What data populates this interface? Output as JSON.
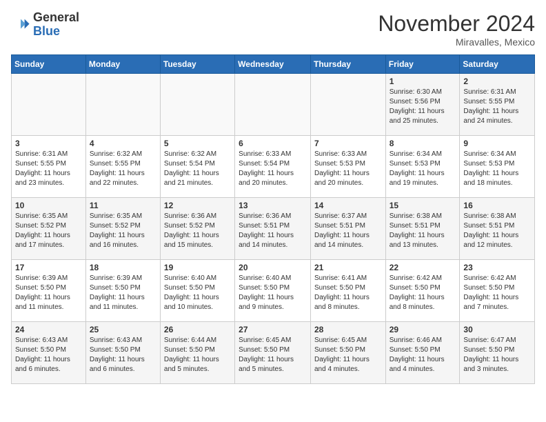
{
  "header": {
    "logo_general": "General",
    "logo_blue": "Blue",
    "month": "November 2024",
    "location": "Miravalles, Mexico"
  },
  "weekdays": [
    "Sunday",
    "Monday",
    "Tuesday",
    "Wednesday",
    "Thursday",
    "Friday",
    "Saturday"
  ],
  "weeks": [
    [
      {
        "day": "",
        "info": ""
      },
      {
        "day": "",
        "info": ""
      },
      {
        "day": "",
        "info": ""
      },
      {
        "day": "",
        "info": ""
      },
      {
        "day": "",
        "info": ""
      },
      {
        "day": "1",
        "info": "Sunrise: 6:30 AM\nSunset: 5:56 PM\nDaylight: 11 hours and 25 minutes."
      },
      {
        "day": "2",
        "info": "Sunrise: 6:31 AM\nSunset: 5:55 PM\nDaylight: 11 hours and 24 minutes."
      }
    ],
    [
      {
        "day": "3",
        "info": "Sunrise: 6:31 AM\nSunset: 5:55 PM\nDaylight: 11 hours and 23 minutes."
      },
      {
        "day": "4",
        "info": "Sunrise: 6:32 AM\nSunset: 5:55 PM\nDaylight: 11 hours and 22 minutes."
      },
      {
        "day": "5",
        "info": "Sunrise: 6:32 AM\nSunset: 5:54 PM\nDaylight: 11 hours and 21 minutes."
      },
      {
        "day": "6",
        "info": "Sunrise: 6:33 AM\nSunset: 5:54 PM\nDaylight: 11 hours and 20 minutes."
      },
      {
        "day": "7",
        "info": "Sunrise: 6:33 AM\nSunset: 5:53 PM\nDaylight: 11 hours and 20 minutes."
      },
      {
        "day": "8",
        "info": "Sunrise: 6:34 AM\nSunset: 5:53 PM\nDaylight: 11 hours and 19 minutes."
      },
      {
        "day": "9",
        "info": "Sunrise: 6:34 AM\nSunset: 5:53 PM\nDaylight: 11 hours and 18 minutes."
      }
    ],
    [
      {
        "day": "10",
        "info": "Sunrise: 6:35 AM\nSunset: 5:52 PM\nDaylight: 11 hours and 17 minutes."
      },
      {
        "day": "11",
        "info": "Sunrise: 6:35 AM\nSunset: 5:52 PM\nDaylight: 11 hours and 16 minutes."
      },
      {
        "day": "12",
        "info": "Sunrise: 6:36 AM\nSunset: 5:52 PM\nDaylight: 11 hours and 15 minutes."
      },
      {
        "day": "13",
        "info": "Sunrise: 6:36 AM\nSunset: 5:51 PM\nDaylight: 11 hours and 14 minutes."
      },
      {
        "day": "14",
        "info": "Sunrise: 6:37 AM\nSunset: 5:51 PM\nDaylight: 11 hours and 14 minutes."
      },
      {
        "day": "15",
        "info": "Sunrise: 6:38 AM\nSunset: 5:51 PM\nDaylight: 11 hours and 13 minutes."
      },
      {
        "day": "16",
        "info": "Sunrise: 6:38 AM\nSunset: 5:51 PM\nDaylight: 11 hours and 12 minutes."
      }
    ],
    [
      {
        "day": "17",
        "info": "Sunrise: 6:39 AM\nSunset: 5:50 PM\nDaylight: 11 hours and 11 minutes."
      },
      {
        "day": "18",
        "info": "Sunrise: 6:39 AM\nSunset: 5:50 PM\nDaylight: 11 hours and 11 minutes."
      },
      {
        "day": "19",
        "info": "Sunrise: 6:40 AM\nSunset: 5:50 PM\nDaylight: 11 hours and 10 minutes."
      },
      {
        "day": "20",
        "info": "Sunrise: 6:40 AM\nSunset: 5:50 PM\nDaylight: 11 hours and 9 minutes."
      },
      {
        "day": "21",
        "info": "Sunrise: 6:41 AM\nSunset: 5:50 PM\nDaylight: 11 hours and 8 minutes."
      },
      {
        "day": "22",
        "info": "Sunrise: 6:42 AM\nSunset: 5:50 PM\nDaylight: 11 hours and 8 minutes."
      },
      {
        "day": "23",
        "info": "Sunrise: 6:42 AM\nSunset: 5:50 PM\nDaylight: 11 hours and 7 minutes."
      }
    ],
    [
      {
        "day": "24",
        "info": "Sunrise: 6:43 AM\nSunset: 5:50 PM\nDaylight: 11 hours and 6 minutes."
      },
      {
        "day": "25",
        "info": "Sunrise: 6:43 AM\nSunset: 5:50 PM\nDaylight: 11 hours and 6 minutes."
      },
      {
        "day": "26",
        "info": "Sunrise: 6:44 AM\nSunset: 5:50 PM\nDaylight: 11 hours and 5 minutes."
      },
      {
        "day": "27",
        "info": "Sunrise: 6:45 AM\nSunset: 5:50 PM\nDaylight: 11 hours and 5 minutes."
      },
      {
        "day": "28",
        "info": "Sunrise: 6:45 AM\nSunset: 5:50 PM\nDaylight: 11 hours and 4 minutes."
      },
      {
        "day": "29",
        "info": "Sunrise: 6:46 AM\nSunset: 5:50 PM\nDaylight: 11 hours and 4 minutes."
      },
      {
        "day": "30",
        "info": "Sunrise: 6:47 AM\nSunset: 5:50 PM\nDaylight: 11 hours and 3 minutes."
      }
    ]
  ]
}
